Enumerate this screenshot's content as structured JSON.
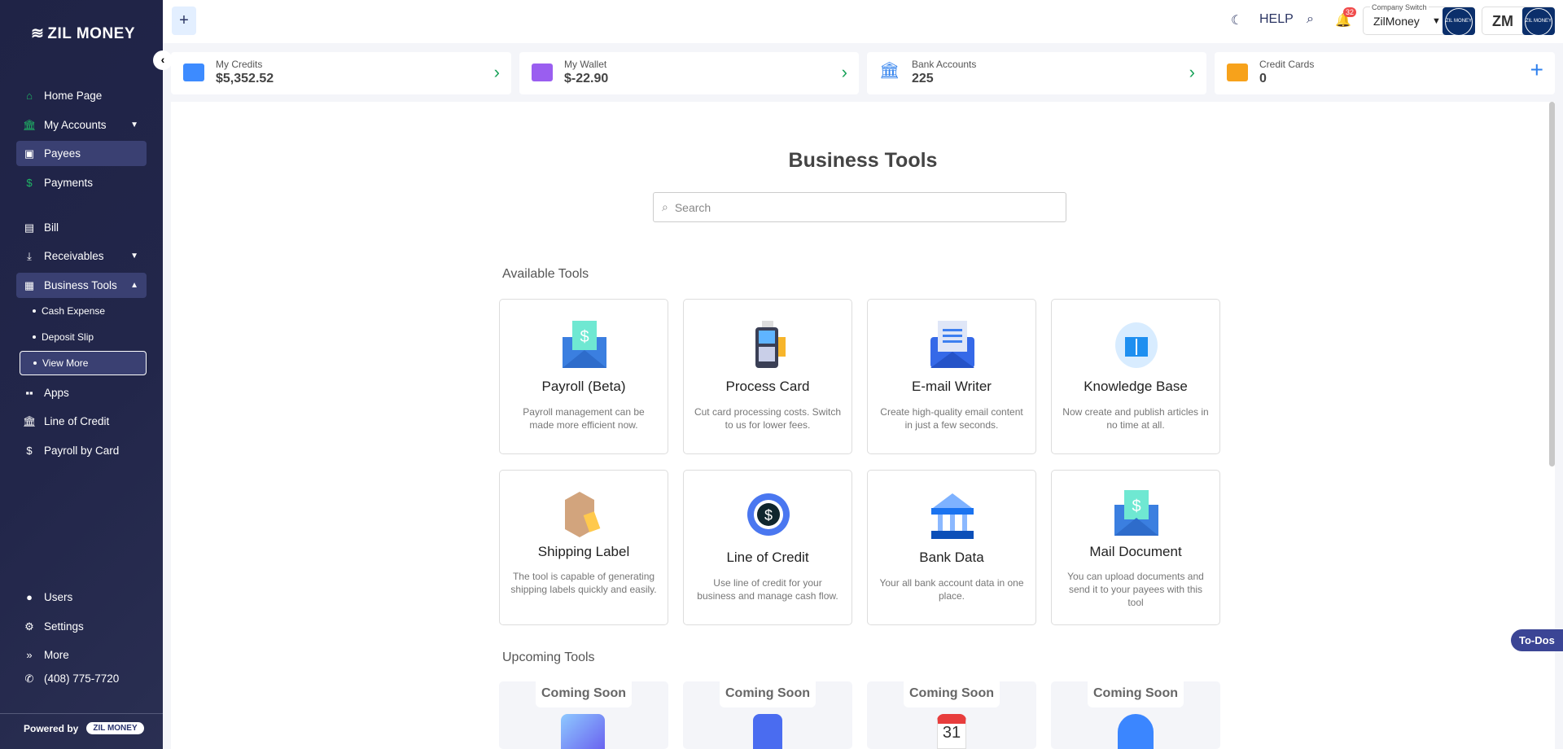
{
  "sidebar": {
    "brand": "ZIL MONEY",
    "items": [
      {
        "label": "Home Page",
        "icon": "home-icon"
      },
      {
        "label": "My Accounts",
        "icon": "bank-icon"
      },
      {
        "label": "Payees",
        "icon": "contact-icon"
      },
      {
        "label": "Payments",
        "icon": "dollar-icon"
      },
      {
        "label": "Bill",
        "icon": "document-icon"
      },
      {
        "label": "Receivables",
        "icon": "receive-icon"
      },
      {
        "label": "Business Tools",
        "icon": "toolbox-icon"
      }
    ],
    "sub_items": [
      "Cash Expense",
      "Deposit Slip",
      "View More"
    ],
    "items2": [
      {
        "label": "Apps"
      },
      {
        "label": "Line of Credit"
      },
      {
        "label": "Payroll by Card"
      }
    ],
    "bottom": [
      {
        "label": "Users"
      },
      {
        "label": "Settings"
      },
      {
        "label": "More"
      },
      {
        "label": "(408) 775-7720"
      }
    ],
    "powered_by": "Powered by",
    "powered_logo": "ZIL MONEY"
  },
  "topbar": {
    "add": "+",
    "help": "HELP",
    "notifications": "32",
    "company_switch_label": "Company Switch",
    "company": "ZilMoney",
    "user_initials": "ZM",
    "logo_text": "ZIL MONEY"
  },
  "summary": [
    {
      "title": "My Credits",
      "value": "$5,352.52",
      "color": "#3d8bff"
    },
    {
      "title": "My Wallet",
      "value": "$-22.90",
      "color": "#9a5ef0"
    },
    {
      "title": "Bank Accounts",
      "value": "225",
      "color": "#2f80ed"
    },
    {
      "title": "Credit Cards",
      "value": "0",
      "color": "#f7a21b"
    }
  ],
  "main": {
    "title": "Business Tools",
    "search_placeholder": "Search",
    "available_label": "Available Tools",
    "upcoming_label": "Upcoming Tools",
    "tools": [
      {
        "name": "Payroll (Beta)",
        "desc": "Payroll management can be made more efficient now."
      },
      {
        "name": "Process Card",
        "desc": "Cut card processing costs. Switch to us for lower fees."
      },
      {
        "name": "E-mail Writer",
        "desc": "Create high-quality email content in just a few seconds."
      },
      {
        "name": "Knowledge Base",
        "desc": "Now create and publish articles in no time at all."
      },
      {
        "name": "Shipping Label",
        "desc": "The tool is capable of generating shipping labels quickly and easily."
      },
      {
        "name": "Line of Credit",
        "desc": "Use line of credit for your business and manage cash flow."
      },
      {
        "name": "Bank Data",
        "desc": "Your all bank account data in one place."
      },
      {
        "name": "Mail Document",
        "desc": "You can upload documents and send it to your payees with this tool"
      }
    ],
    "upcoming": [
      "Coming Soon",
      "Coming Soon",
      "Coming Soon",
      "Coming Soon"
    ],
    "calendar_day": "31"
  },
  "todos": "To-Dos"
}
